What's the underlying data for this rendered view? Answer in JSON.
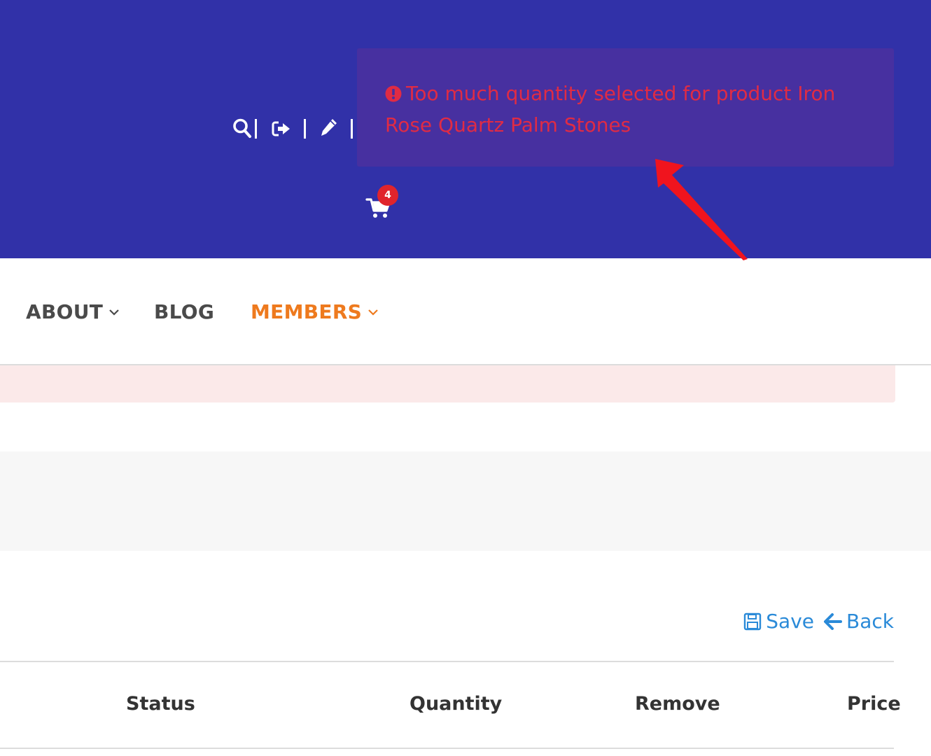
{
  "header": {
    "bg_color": "#3131a8",
    "icons": [
      "search-icon",
      "sign-out-icon",
      "pencil-icon"
    ],
    "cart": {
      "icon": "cart-icon",
      "badge_count": "4"
    }
  },
  "toast": {
    "icon": "exclamation-circle-icon",
    "message": "Too much quantity selected for product Iron Rose Quartz Palm Stones",
    "text_color": "#e02b44",
    "bg_color": "#4730a0"
  },
  "nav": {
    "items": [
      {
        "label": "ABOUT",
        "has_dropdown": true,
        "active": false
      },
      {
        "label": "BLOG",
        "has_dropdown": false,
        "active": false
      },
      {
        "label": "MEMBERS",
        "has_dropdown": true,
        "active": true
      }
    ],
    "active_color": "#ee7a1e"
  },
  "actions": {
    "save_label": "Save",
    "back_label": "Back",
    "link_color": "#2a8ad8"
  },
  "table": {
    "headers": [
      "Status",
      "Quantity",
      "Remove",
      "Price"
    ]
  },
  "annotation": {
    "arrow_color": "#f0141e"
  }
}
